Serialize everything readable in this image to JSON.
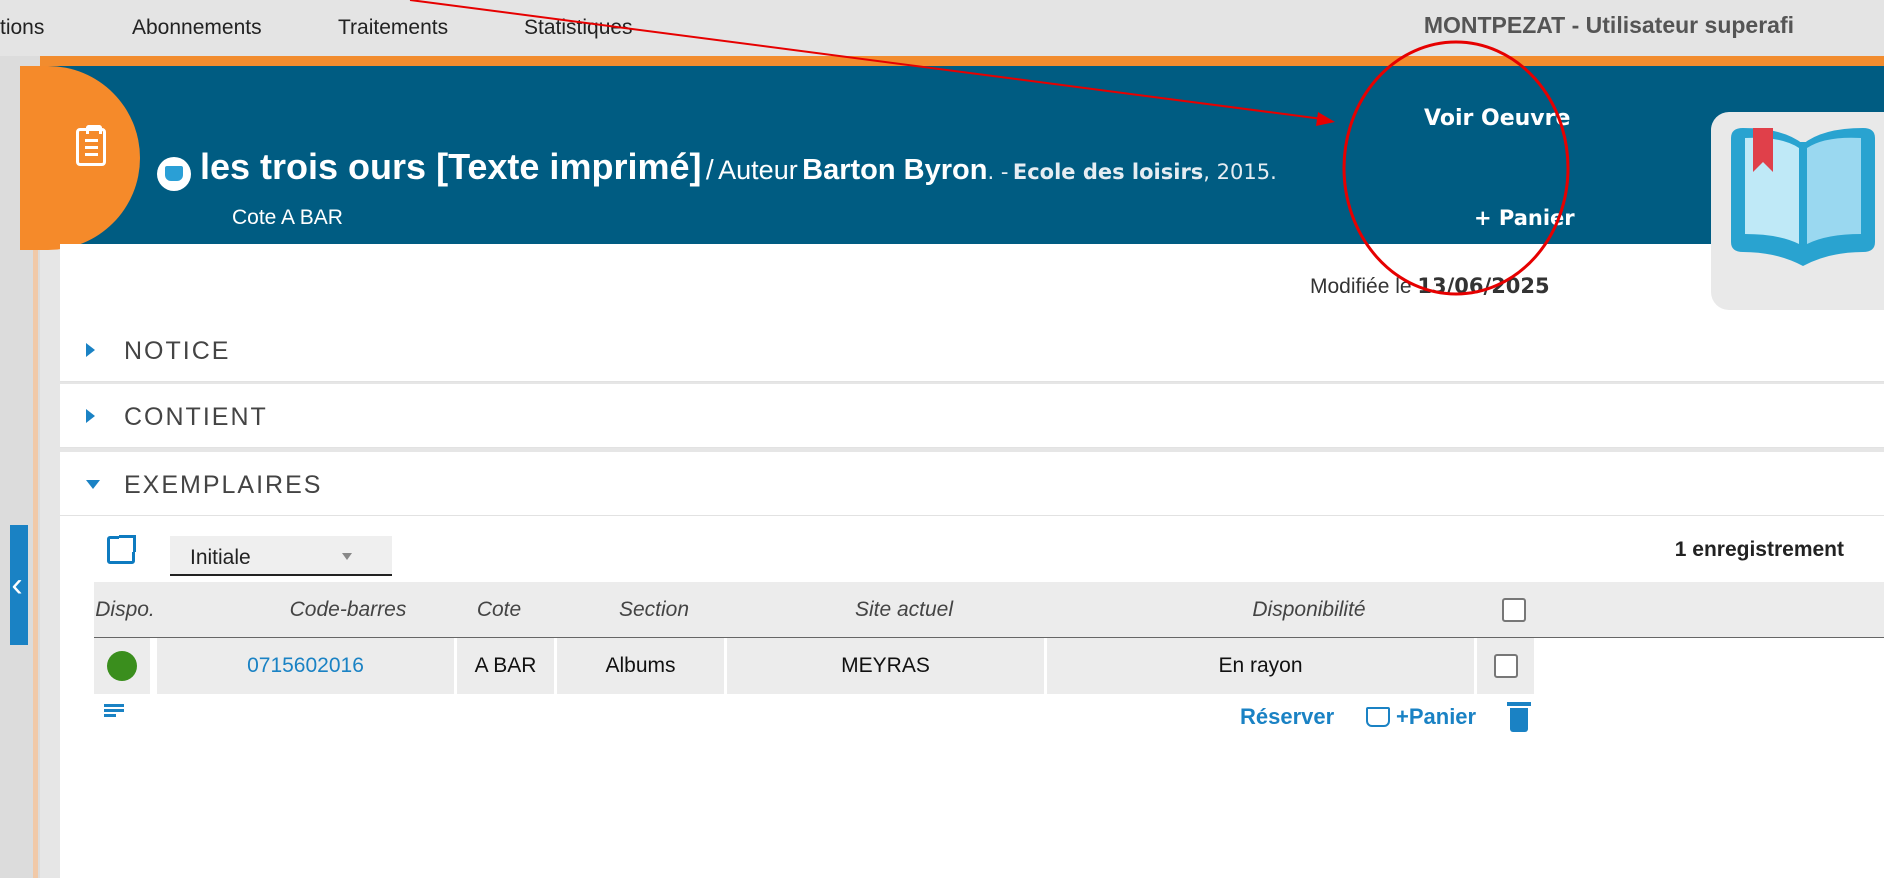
{
  "topnav": {
    "items": [
      "tions",
      "Abonnements",
      "Traitements",
      "Statistiques"
    ],
    "user": "MONTPEZAT - Utilisateur superafi"
  },
  "record": {
    "title": "les trois ours [Texte imprimé]",
    "separator": "/",
    "author_prefix": "Auteur",
    "author": "Barton Byron",
    "publisher_prefix": ". -",
    "publisher": "Ecole des loisirs",
    "year_suffix": ", 2015.",
    "cote": "Cote A BAR",
    "voir_oeuvre": "Voir Oeuvre",
    "panier": "+ Panier",
    "modified_prefix": "Modifiée le",
    "modified_date": "13/06/2025",
    "colors": {
      "header": "#005c82",
      "accent": "#f58a2a",
      "link": "#1a82c4"
    }
  },
  "sections": [
    {
      "label": "NOTICE",
      "expanded": false
    },
    {
      "label": "CONTIENT",
      "expanded": false
    },
    {
      "label": "EXEMPLAIRES",
      "expanded": true
    }
  ],
  "exemplaires": {
    "view": "Initiale",
    "record_count": "1 enregistrement",
    "columns": [
      "Dispo.",
      "Code-barres",
      "Cote",
      "Section",
      "Site actuel",
      "Disponibilité"
    ],
    "rows": [
      {
        "dispo": "available",
        "barcode": "0715602016",
        "cote": "A BAR",
        "section": "Albums",
        "site": "MEYRAS",
        "availability": "En rayon"
      }
    ],
    "actions": {
      "reserve": "Réserver",
      "basket": "+Panier"
    }
  },
  "icons": [
    "document-icon",
    "book-type-icon",
    "book-cover-icon",
    "pin-icon",
    "export-icon",
    "add-lines-icon",
    "basket-add-icon",
    "trash-icon",
    "chevron-left-icon"
  ]
}
